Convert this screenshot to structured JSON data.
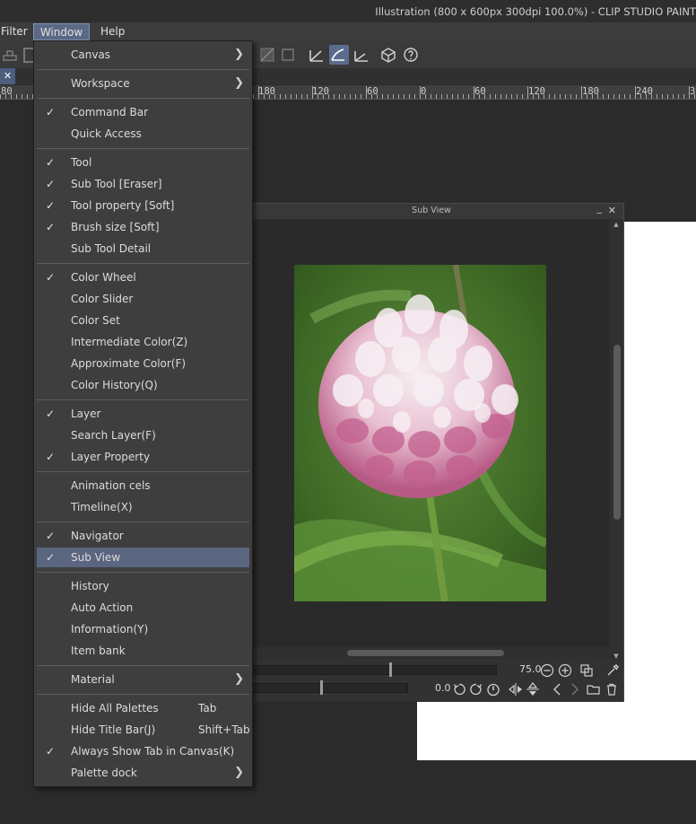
{
  "app": {
    "title": "Illustration (800 x 600px 300dpi 100.0%)  - CLIP STUDIO PAINT"
  },
  "menubar": {
    "items": [
      {
        "label": "Filter"
      },
      {
        "label": "Window"
      },
      {
        "label": "Help"
      }
    ]
  },
  "ruler": {
    "labels": [
      "80",
      "180",
      "120",
      "60",
      "0",
      "60",
      "120",
      "180",
      "240",
      "3"
    ]
  },
  "window_menu": {
    "items": [
      {
        "label": "Canvas",
        "submenu": true
      },
      {
        "label": "Workspace",
        "submenu": true
      },
      {
        "label": "Command Bar",
        "checked": true
      },
      {
        "label": "Quick Access"
      },
      {
        "label": "Tool",
        "checked": true
      },
      {
        "label": "Sub Tool [Eraser]",
        "checked": true
      },
      {
        "label": "Tool property [Soft]",
        "checked": true
      },
      {
        "label": "Brush size [Soft]",
        "checked": true
      },
      {
        "label": "Sub Tool Detail"
      },
      {
        "label": "Color Wheel",
        "checked": true
      },
      {
        "label": "Color Slider"
      },
      {
        "label": "Color Set"
      },
      {
        "label": "Intermediate Color(Z)"
      },
      {
        "label": "Approximate Color(F)"
      },
      {
        "label": "Color History(Q)"
      },
      {
        "label": "Layer",
        "checked": true
      },
      {
        "label": "Search Layer(F)"
      },
      {
        "label": "Layer Property",
        "checked": true
      },
      {
        "label": "Animation cels"
      },
      {
        "label": "Timeline(X)"
      },
      {
        "label": "Navigator",
        "checked": true
      },
      {
        "label": "Sub View",
        "checked": true,
        "selected": true
      },
      {
        "label": "History"
      },
      {
        "label": "Auto Action"
      },
      {
        "label": "Information(Y)"
      },
      {
        "label": "Item bank"
      },
      {
        "label": "Material",
        "submenu": true
      },
      {
        "label": "Hide All Palettes",
        "shortcut": "Tab"
      },
      {
        "label": "Hide Title Bar(J)",
        "shortcut": "Shift+Tab"
      },
      {
        "label": "Always Show Tab in Canvas(K)",
        "checked": true
      },
      {
        "label": "Palette dock",
        "submenu": true
      }
    ],
    "check_glyph": "✓",
    "arrow_glyph": "❯"
  },
  "sub_view": {
    "title": "Sub View",
    "zoom_value": "75.0",
    "rotate_value": "0.0",
    "zoom_level": 0.58,
    "rotate_level": 0.47
  },
  "icons": {
    "tab_close": "✕",
    "palette_min": "_",
    "palette_close": "✕",
    "scroll_up": "▲",
    "scroll_down": "▼"
  }
}
